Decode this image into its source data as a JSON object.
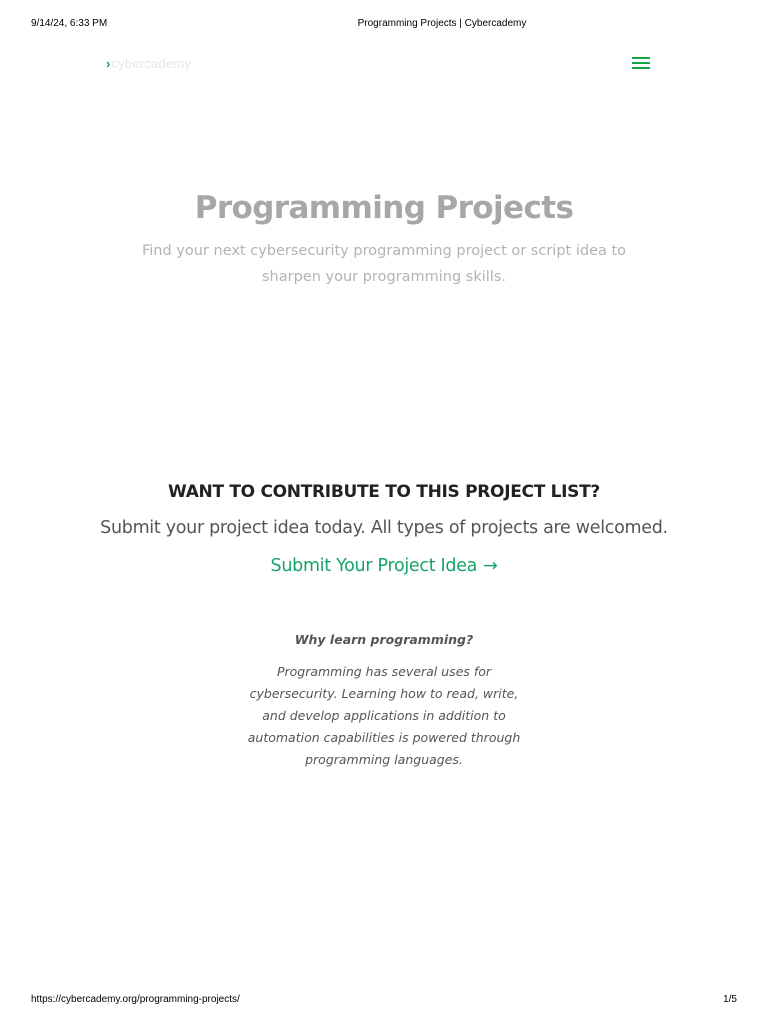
{
  "print_header": {
    "datetime": "9/14/24, 6:33 PM",
    "title": "Programming Projects | Cybercademy"
  },
  "navbar": {
    "logo_chevron": "›",
    "logo_text": "cybercademy",
    "menu_icon": "hamburger-icon",
    "accent_color": "#16a34a"
  },
  "hero": {
    "title": "Programming Projects",
    "subtitle": "Find your next cybersecurity programming project or script idea to sharpen your programming skills."
  },
  "contribute": {
    "heading": "WANT TO CONTRIBUTE TO THIS PROJECT LIST?",
    "subtext": "Submit your project idea today. All types of projects are welcomed.",
    "cta_label": "Submit Your Project Idea",
    "cta_arrow": "→"
  },
  "why": {
    "heading": "Why learn programming?",
    "body": "Programming has several uses for cybersecurity. Learning how to read, write, and develop applications in addition to automation capabilities is powered through programming languages."
  },
  "print_footer": {
    "url": "https://cybercademy.org/programming-projects/",
    "page": "1/5"
  }
}
